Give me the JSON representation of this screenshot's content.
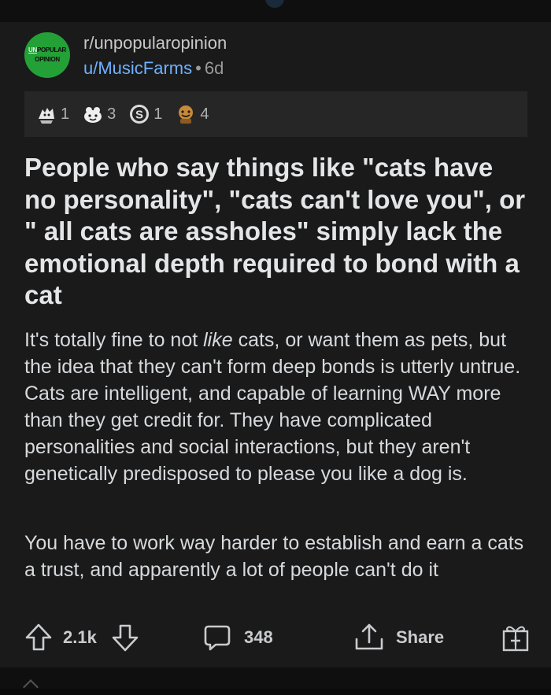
{
  "post": {
    "subreddit": "r/unpopularopinion",
    "author": "u/MusicFarms",
    "separator": "•",
    "age": "6d",
    "subreddit_icon": {
      "line1_prefix": "UN",
      "line1_rest": "POPULAR",
      "line2": "OPINION",
      "color": "#23a137"
    },
    "awards": [
      {
        "icon": "wholesome-award-icon",
        "count": "1"
      },
      {
        "icon": "helpful-award-icon",
        "count": "3"
      },
      {
        "icon": "silver-award-icon",
        "count": "1"
      },
      {
        "icon": "bravo-award-icon",
        "count": "4"
      }
    ],
    "title": "People who say things like \"cats have no personality\", \"cats can't love you\", or \" all cats are assholes\" simply lack the emotional depth required to bond with a cat",
    "body_p1_before": "It's totally fine to not ",
    "body_p1_em": "like",
    "body_p1_after": " cats, or want them as pets, but the idea that they can't form deep bonds is utterly untrue.  Cats are intelligent, and capable of learning WAY more than they get credit for.  They have complicated personalities and social interactions, but they aren't genetically predisposed to please you like a dog is.",
    "body_p2": "You have to work way harder to establish and earn a cats a trust, and apparently a lot of people can't do it"
  },
  "actions": {
    "upvote_icon": "arrow-up-icon",
    "votes": "2.1k",
    "downvote_icon": "arrow-down-icon",
    "comment_icon": "speech-bubble-icon",
    "comments": "348",
    "share_icon": "share-upload-icon",
    "share_label": "Share",
    "award_icon": "gift-award-icon"
  },
  "colors": {
    "background": "#1a1a1b",
    "link": "#6fb1ff",
    "text": "#d7dadc"
  }
}
